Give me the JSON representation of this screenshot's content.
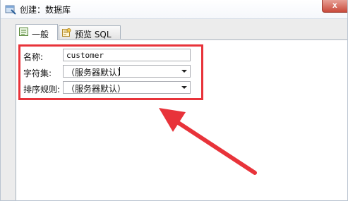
{
  "window": {
    "title": "创建：数据库",
    "close_symbol": "x"
  },
  "tabs": [
    {
      "label": "一般",
      "icon": "general-form-icon",
      "active": true
    },
    {
      "label": "预览 SQL",
      "icon": "sql-preview-icon",
      "active": false
    }
  ],
  "form": {
    "name_label": "名称:",
    "name_value": "customer",
    "charset_label": "字符集:",
    "charset_value": "（服务器默认）",
    "collation_label": "排序规则:",
    "collation_value": "（服务器默认）"
  },
  "colors": {
    "annotation_red": "#e8333a"
  },
  "icons": {
    "app": "database-create-icon",
    "dropdown": "chevron-down-icon"
  }
}
